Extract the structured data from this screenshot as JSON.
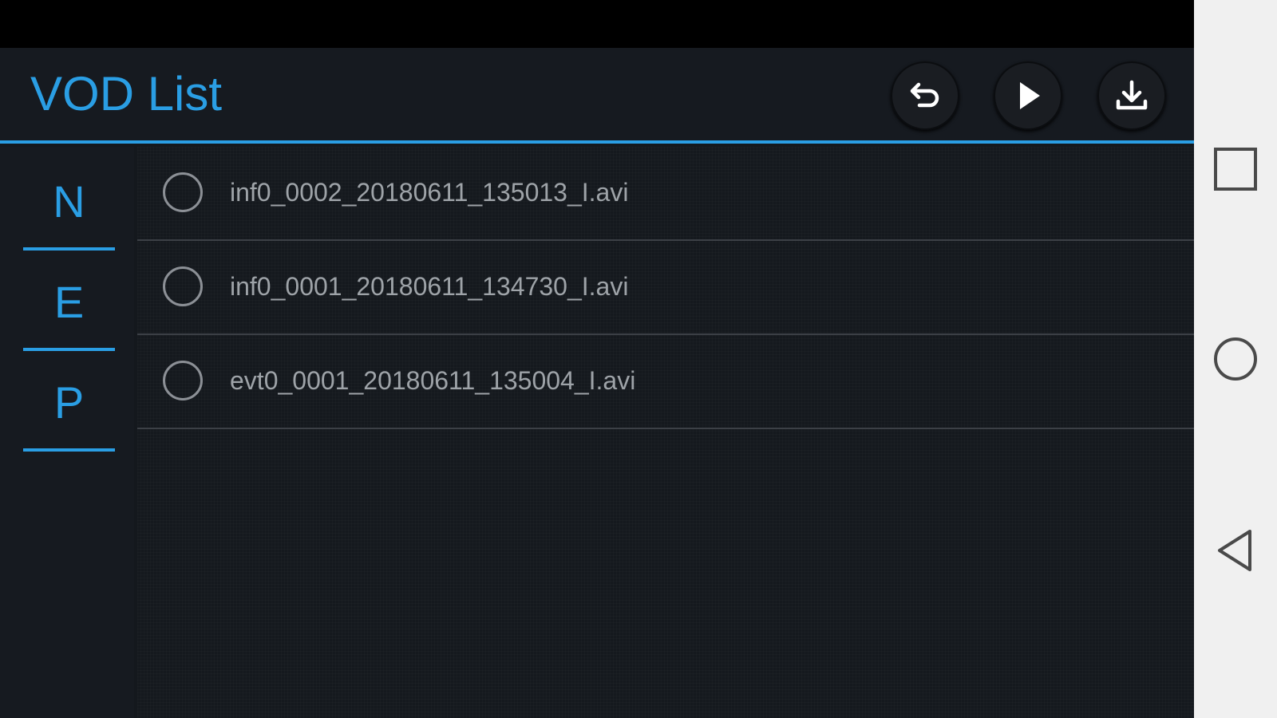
{
  "header": {
    "title": "VOD List",
    "buttons": [
      {
        "name": "back",
        "icon": "undo-arrow-icon"
      },
      {
        "name": "play",
        "icon": "play-icon"
      },
      {
        "name": "download",
        "icon": "download-icon"
      }
    ]
  },
  "sidebar": {
    "tabs": [
      {
        "label": "N"
      },
      {
        "label": "E"
      },
      {
        "label": "P"
      }
    ]
  },
  "files": [
    {
      "name": "inf0_0002_20180611_135013_I.avi",
      "selected": false
    },
    {
      "name": "inf0_0001_20180611_134730_I.avi",
      "selected": false
    },
    {
      "name": "evt0_0001_20180611_135004_I.avi",
      "selected": false
    }
  ],
  "system_nav": {
    "icons": [
      "recent-apps-icon",
      "home-icon",
      "back-icon"
    ]
  },
  "colors": {
    "accent": "#2a9ee4",
    "background": "#14181d",
    "text": "#9ea3a8",
    "nav_background": "#f0f0f0"
  }
}
